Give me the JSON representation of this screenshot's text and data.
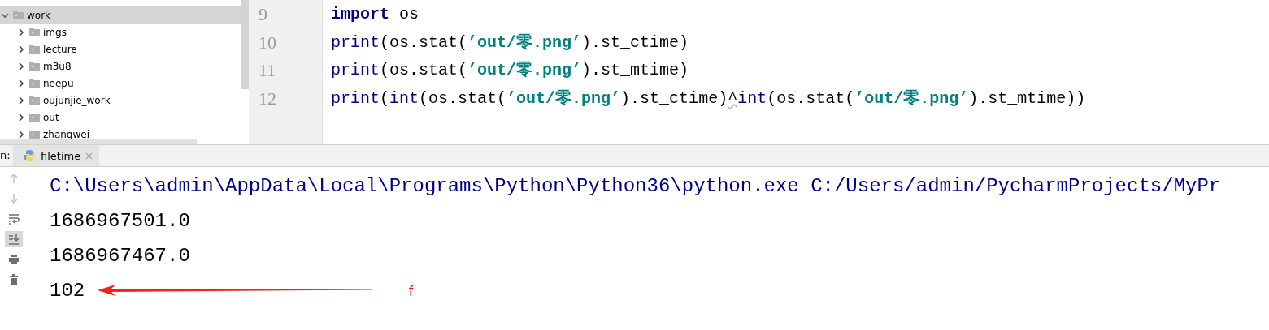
{
  "project_tree": {
    "items": [
      {
        "name": "work",
        "expanded": true,
        "selected": true,
        "children": [
          {
            "name": "imgs",
            "expanded": false,
            "selected": false
          },
          {
            "name": "lecture",
            "expanded": false,
            "selected": false
          },
          {
            "name": "m3u8",
            "expanded": false,
            "selected": false
          },
          {
            "name": "neepu",
            "expanded": false,
            "selected": false
          },
          {
            "name": "oujunjie_work",
            "expanded": false,
            "selected": false
          },
          {
            "name": "out",
            "expanded": false,
            "selected": false
          },
          {
            "name": "zhangwei",
            "expanded": false,
            "selected": false
          }
        ]
      }
    ]
  },
  "editor": {
    "lines": [
      {
        "number": "9",
        "tokens": [
          {
            "kind": "keyword",
            "text": "import"
          },
          {
            "kind": "plain",
            "text": " os"
          }
        ]
      },
      {
        "number": "10",
        "tokens": [
          {
            "kind": "builtin",
            "text": "print"
          },
          {
            "kind": "plain",
            "text": "(os.stat("
          },
          {
            "kind": "string",
            "text": "’out/零.png’"
          },
          {
            "kind": "plain",
            "text": ").st_ctime)"
          }
        ]
      },
      {
        "number": "11",
        "tokens": [
          {
            "kind": "builtin",
            "text": "print"
          },
          {
            "kind": "plain",
            "text": "(os.stat("
          },
          {
            "kind": "string",
            "text": "’out/零.png’"
          },
          {
            "kind": "plain",
            "text": ").st_mtime)"
          }
        ]
      },
      {
        "number": "12",
        "tokens": [
          {
            "kind": "builtin",
            "text": "print"
          },
          {
            "kind": "plain",
            "text": "("
          },
          {
            "kind": "builtin",
            "text": "int"
          },
          {
            "kind": "plain",
            "text": "(os.stat("
          },
          {
            "kind": "string",
            "text": "’out/零.png’"
          },
          {
            "kind": "plain",
            "text": ").st_ctime)"
          },
          {
            "kind": "warning",
            "text": "^"
          },
          {
            "kind": "builtin",
            "text": "int"
          },
          {
            "kind": "plain",
            "text": "(os.stat("
          },
          {
            "kind": "string",
            "text": "’out/零.png’"
          },
          {
            "kind": "plain",
            "text": ").st_mtime))"
          }
        ]
      }
    ]
  },
  "run_panel": {
    "label": "n:",
    "tabs": [
      {
        "title": "filetime",
        "selected": true
      }
    ],
    "toolbar": [
      {
        "kind": "up",
        "disabled": true,
        "selected": false
      },
      {
        "kind": "down",
        "disabled": true,
        "selected": false
      },
      {
        "kind": "wrap",
        "disabled": false,
        "selected": false
      },
      {
        "kind": "scroll-end",
        "disabled": false,
        "selected": true
      },
      {
        "kind": "print",
        "disabled": false,
        "selected": false
      },
      {
        "kind": "trash",
        "disabled": false,
        "selected": false
      }
    ],
    "output": [
      {
        "kind": "command",
        "text": "C:\\Users\\admin\\AppData\\Local\\Programs\\Python\\Python36\\python.exe C:/Users/admin/PycharmProjects/MyPr"
      },
      {
        "kind": "stdout",
        "text": "1686967501.0"
      },
      {
        "kind": "stdout",
        "text": "1686967467.0"
      },
      {
        "kind": "stdout",
        "text": "102"
      }
    ],
    "annotation": {
      "label": "f"
    }
  }
}
